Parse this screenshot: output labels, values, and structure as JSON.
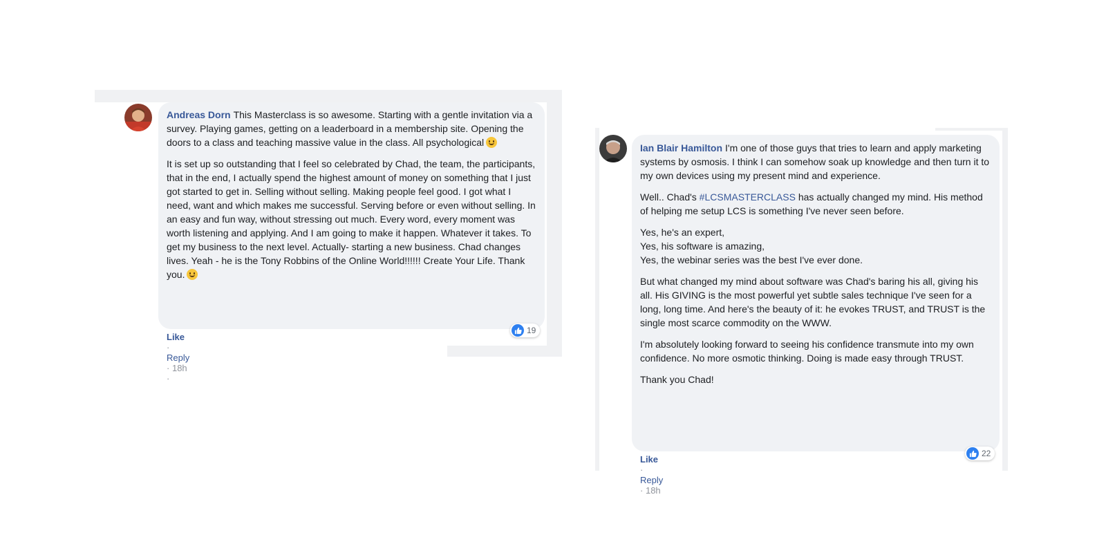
{
  "comments": [
    {
      "author": "Andreas Dorn",
      "paragraphs": [
        "This Masterclass is so awesome. Starting with a gentle invitation via a survey. Playing games, getting on a leaderboard in a membership site. Opening the doors to a class and teaching massive value in the class. All psychological",
        "It is set up so outstanding that I feel so celebrated by Chad, the team, the participants, that in the end, I actually spend the highest amount of money on something that I just got started to get in. Selling without selling. Making people feel good. I got what I need, want and which makes me successful. Serving before or even without selling. In an easy and fun way, without stressing out much. Every word, every moment was worth listening and applying. And I am going to make it happen. Whatever it takes. To get my business to the next level. Actually- starting a new business. Chad changes lives. Yeah - he is the Tony Robbins of the Online World!!!!!! Create Your Life. Thank you."
      ],
      "actions": {
        "like": "Like",
        "reply": "Reply",
        "time": "18h",
        "sep": "·"
      },
      "reaction_count": "19",
      "reaction_icon": "thumbs-up-icon",
      "emoji_icon": "smile-emoji-icon"
    },
    {
      "author": "Ian Blair Hamilton",
      "p1": "I'm one of those guys that tries to learn and apply marketing systems by osmosis. I think I can somehow soak up knowledge and then turn it to my own devices using my present mind and experience.",
      "p2_pre": "Well.. Chad's ",
      "p2_tag": "#LCSMASTERCLASS",
      "p2_post": " has actually changed my mind. His method of helping me setup LCS is something I've never seen before.",
      "p3": "Yes, he's an expert,\nYes, his software is amazing,\nYes, the webinar series was the best I've ever done.",
      "p4": "But what changed my mind about software was Chad's baring his all, giving his all. His GIVING is the most powerful yet subtle sales technique I've seen for a long, long time. And here's the beauty of it: he evokes TRUST, and TRUST is the single most scarce commodity on the WWW.",
      "p5": "I'm absolutely looking forward to seeing his confidence transmute into my own confidence. No more osmotic thinking. Doing is made easy through TRUST.",
      "p6": "Thank you Chad!",
      "actions": {
        "like": "Like",
        "reply": "Reply",
        "time": "18h",
        "sep": "·"
      },
      "reaction_count": "22",
      "reaction_icon": "thumbs-up-icon"
    }
  ],
  "colors": {
    "author": "#385898",
    "bubble": "#f0f2f5",
    "like_blue": "#2e80f0"
  }
}
